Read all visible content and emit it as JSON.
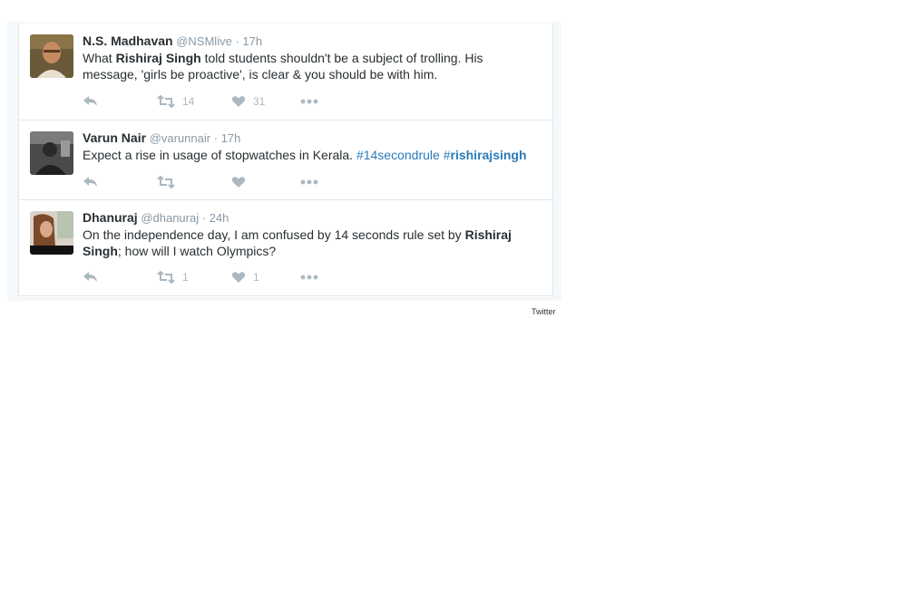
{
  "colors": {
    "text": "#292f33",
    "muted": "#8899a6",
    "icon": "#aab8c2",
    "hashtag": "#2b7bb9",
    "border": "#e1e8ed"
  },
  "tweets": [
    {
      "name": "N.S. Madhavan",
      "handle": "@NSMlive",
      "sep": "·",
      "time": "17h",
      "text_parts": {
        "t1": "What ",
        "b1": "Rishiraj Singh",
        "t2": " told students shouldn't be a subject of trolling. His message, 'girls be proactive', is clear & you should be with him."
      },
      "retweets": "14",
      "likes": "31"
    },
    {
      "name": "Varun Nair",
      "handle": "@varunnair",
      "sep": "·",
      "time": "17h",
      "text_parts": {
        "t1": "Expect a rise in usage of stopwatches in Kerala. ",
        "h1": "#14secondrule",
        "h2_prefix": "#",
        "h2_bold": "rishirajsingh"
      },
      "retweets": "",
      "likes": ""
    },
    {
      "name": "Dhanuraj",
      "handle": "@dhanuraj",
      "sep": "·",
      "time": "24h",
      "text_parts": {
        "t1": "On the independence day, I am confused by 14 seconds rule set by ",
        "b1": "Rishiraj Singh",
        "t2": "; how will I watch Olympics?"
      },
      "retweets": "1",
      "likes": "1"
    }
  ],
  "icons": [
    "reply-icon",
    "retweet-icon",
    "like-icon",
    "more-icon"
  ],
  "watermark": "Twitter"
}
